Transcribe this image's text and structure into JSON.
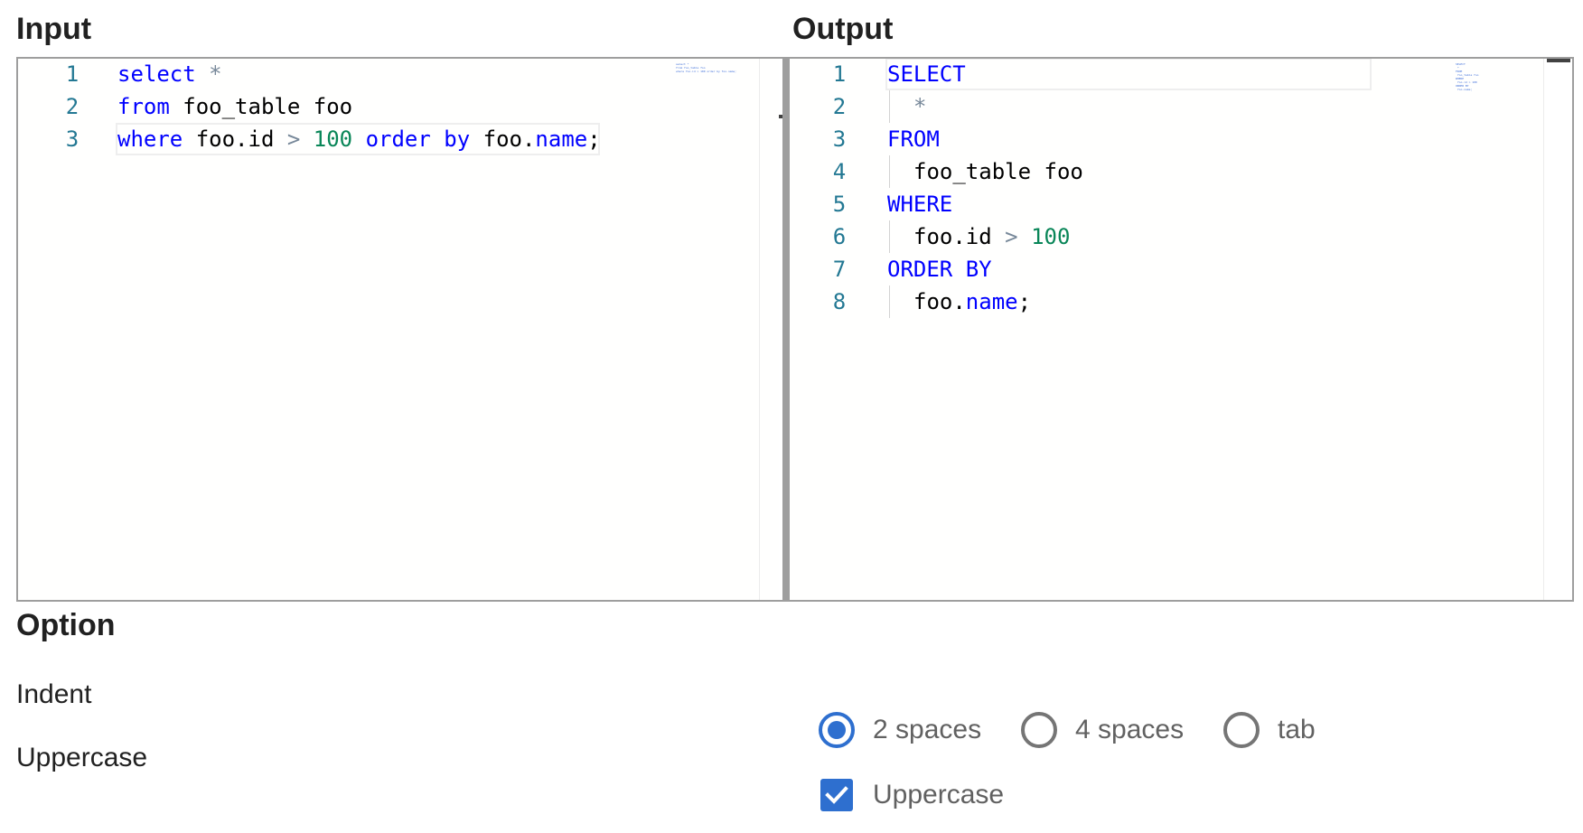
{
  "input": {
    "heading": "Input",
    "lines": [
      {
        "num": "1",
        "tokens": [
          {
            "t": "select",
            "c": "kw"
          },
          {
            "t": " ",
            "c": "id"
          },
          {
            "t": "*",
            "c": "op"
          }
        ]
      },
      {
        "num": "2",
        "tokens": [
          {
            "t": "from",
            "c": "kw"
          },
          {
            "t": " foo_table foo",
            "c": "id"
          }
        ]
      },
      {
        "num": "3",
        "tokens": [
          {
            "t": "where",
            "c": "kw"
          },
          {
            "t": " foo.id ",
            "c": "id"
          },
          {
            "t": ">",
            "c": "op"
          },
          {
            "t": " ",
            "c": "id"
          },
          {
            "t": "100",
            "c": "num"
          },
          {
            "t": " ",
            "c": "id"
          },
          {
            "t": "order",
            "c": "kw"
          },
          {
            "t": " ",
            "c": "id"
          },
          {
            "t": "by",
            "c": "kw"
          },
          {
            "t": " foo.",
            "c": "id"
          },
          {
            "t": "name",
            "c": "prop"
          },
          {
            "t": ";",
            "c": "id"
          }
        ]
      }
    ]
  },
  "output": {
    "heading": "Output",
    "lines": [
      {
        "num": "1",
        "indent": 0,
        "tokens": [
          {
            "t": "SELECT",
            "c": "kw"
          }
        ]
      },
      {
        "num": "2",
        "indent": 1,
        "tokens": [
          {
            "t": "*",
            "c": "op"
          }
        ]
      },
      {
        "num": "3",
        "indent": 0,
        "tokens": [
          {
            "t": "FROM",
            "c": "kw"
          }
        ]
      },
      {
        "num": "4",
        "indent": 1,
        "tokens": [
          {
            "t": "foo_table foo",
            "c": "id"
          }
        ]
      },
      {
        "num": "5",
        "indent": 0,
        "tokens": [
          {
            "t": "WHERE",
            "c": "kw"
          }
        ]
      },
      {
        "num": "6",
        "indent": 1,
        "tokens": [
          {
            "t": "foo.id ",
            "c": "id"
          },
          {
            "t": ">",
            "c": "op"
          },
          {
            "t": " ",
            "c": "id"
          },
          {
            "t": "100",
            "c": "num"
          }
        ]
      },
      {
        "num": "7",
        "indent": 0,
        "tokens": [
          {
            "t": "ORDER BY",
            "c": "kw"
          }
        ]
      },
      {
        "num": "8",
        "indent": 1,
        "tokens": [
          {
            "t": "foo.",
            "c": "id"
          },
          {
            "t": "name",
            "c": "prop"
          },
          {
            "t": ";",
            "c": "id"
          }
        ]
      }
    ]
  },
  "options": {
    "heading": "Option",
    "indent_label": "Indent",
    "uppercase_label": "Uppercase",
    "indent_choices": [
      {
        "label": "2 spaces",
        "checked": true
      },
      {
        "label": "4 spaces",
        "checked": false
      },
      {
        "label": "tab",
        "checked": false
      }
    ],
    "uppercase_checkbox": {
      "label": "Uppercase",
      "checked": true
    }
  },
  "colors": {
    "keyword": "#0000ff",
    "operator": "#778899",
    "number": "#098658",
    "line_number": "#237893",
    "accent": "#2e6fcf"
  }
}
